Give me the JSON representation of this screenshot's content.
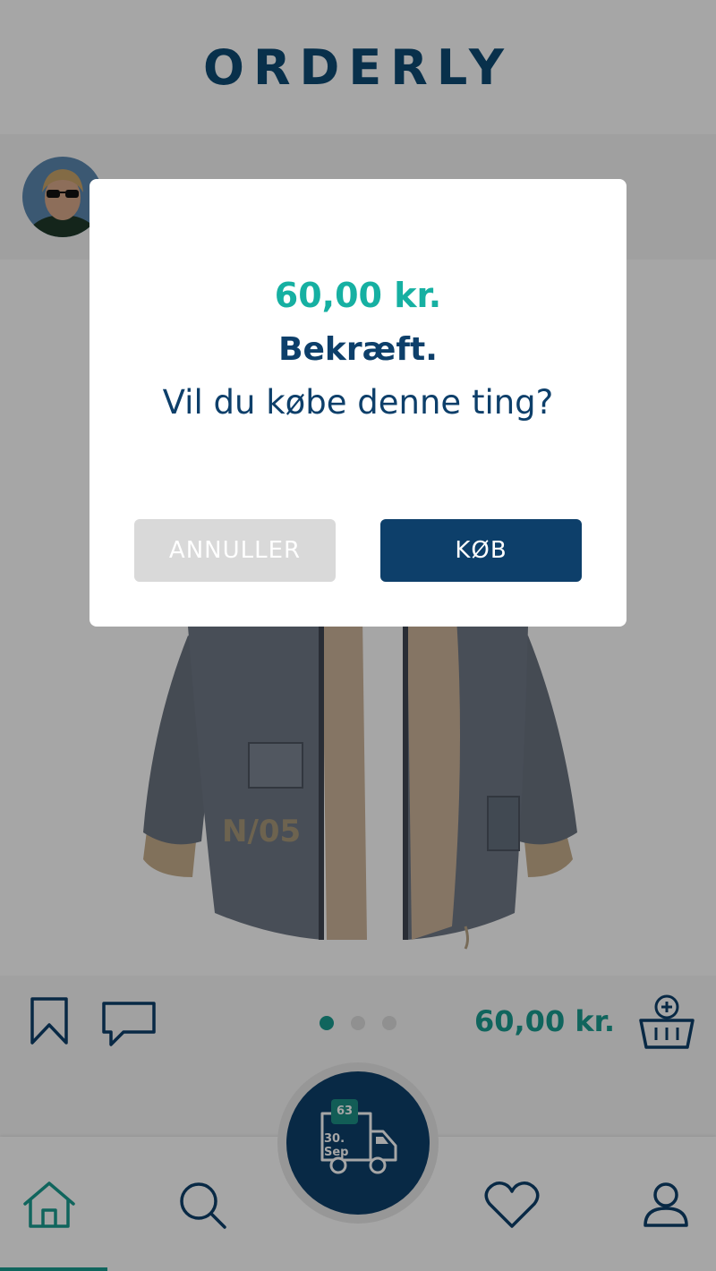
{
  "header": {
    "logo_text": "ORDERLY"
  },
  "product": {
    "price": "60,00 kr.",
    "carousel": {
      "total": 3,
      "active_index": 0
    }
  },
  "truck": {
    "badge": "63",
    "date": "30. Sep"
  },
  "modal": {
    "price": "60,00 kr.",
    "title": "Bekræft.",
    "question": "Vil du købe denne ting?",
    "cancel_label": "ANNULLER",
    "buy_label": "KØB"
  },
  "nav": {
    "items": [
      "home-icon",
      "search-icon",
      "heart-icon",
      "profile-icon"
    ],
    "active": "home"
  },
  "colors": {
    "teal": "#199b8f",
    "navy": "#0d3f6a",
    "modal_price": "#16b0a2"
  }
}
